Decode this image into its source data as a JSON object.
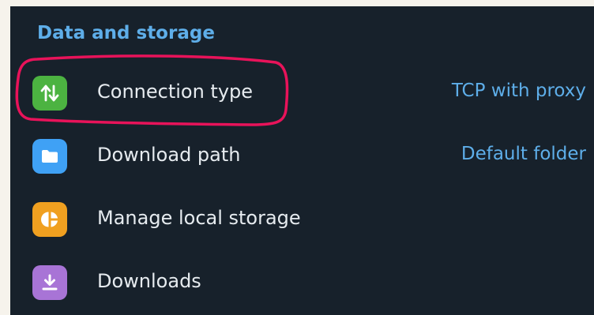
{
  "section": {
    "title": "Data and storage"
  },
  "items": [
    {
      "label": "Connection type",
      "value": "TCP with proxy",
      "icon": "connection-arrows-icon",
      "color": "#4cb341"
    },
    {
      "label": "Download path",
      "value": "Default folder",
      "icon": "folder-icon",
      "color": "#3fa1f5"
    },
    {
      "label": "Manage local storage",
      "value": "",
      "icon": "pie-chart-icon",
      "color": "#f0a020"
    },
    {
      "label": "Downloads",
      "value": "",
      "icon": "download-icon",
      "color": "#a874d6"
    }
  ],
  "annotation": {
    "color": "#e8135a"
  }
}
